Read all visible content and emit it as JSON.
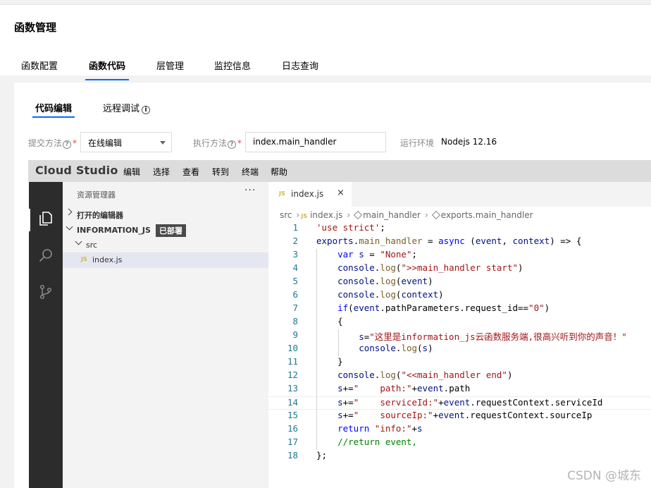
{
  "page": {
    "title": "函数管理"
  },
  "main_tabs": [
    "函数配置",
    "函数代码",
    "层管理",
    "监控信息",
    "日志查询"
  ],
  "sub_tabs": {
    "code_edit": "代码编辑",
    "remote_debug": "远程调试"
  },
  "form": {
    "submit_method_label": "提交方法",
    "submit_method_value": "在线编辑",
    "exec_method_label": "执行方法",
    "exec_method_value": "index.main_handler",
    "runtime_label": "运行环境",
    "runtime_value": "Nodejs 12.16",
    "help_glyph": "?",
    "required_mark": "*",
    "info_glyph": "i"
  },
  "ide": {
    "brand": "Cloud Studio",
    "menus": [
      "编辑",
      "选择",
      "查看",
      "转到",
      "终端",
      "帮助"
    ],
    "explorer": {
      "title": "资源管理器",
      "more": "···",
      "open_editors": "打开的编辑器",
      "project": "INFORMATION_JS",
      "deployed_badge": "已部署",
      "folder": "src",
      "file": "index.js",
      "file_badge": "JS"
    },
    "editor_tab": {
      "label": "index.js",
      "badge": "JS",
      "close": "×"
    },
    "breadcrumbs": [
      "src",
      "index.js",
      "main_handler",
      "exports.main_handler"
    ],
    "code_lines": [
      "'use strict';",
      "exports.main_handler = async (event, context) => {",
      "    var s = \"None\";",
      "    console.log(\">>main_handler start\")",
      "    console.log(event)",
      "    console.log(context)",
      "    if(event.pathParameters.request_id==\"0\")",
      "    {",
      "        s=\"这里是information_js云函数服务端,很高兴听到你的声音！\"",
      "        console.log(s)",
      "    }",
      "    console.log(\"<<main_handler end\")",
      "    s+=\"    path:\"+event.path",
      "    s+=\"    serviceId:\"+event.requestContext.serviceId",
      "    s+=\"    sourceIp:\"+event.requestContext.sourceIp",
      "    return \"info:\"+s",
      "    //return event,",
      "};"
    ]
  },
  "colors": {
    "accent": "#006eff",
    "activity_bar": "#2c2c2c",
    "keyword": "#0000ff",
    "string": "#a31515",
    "line_number": "#237893",
    "comment": "#008000"
  },
  "icons": [
    "explorer-files-icon",
    "search-icon",
    "source-control-icon",
    "info-icon",
    "help-icon",
    "chevron-right-icon",
    "chevron-down-icon",
    "js-file-icon",
    "close-icon",
    "symbol-method-icon"
  ],
  "watermark": "CSDN @城东"
}
